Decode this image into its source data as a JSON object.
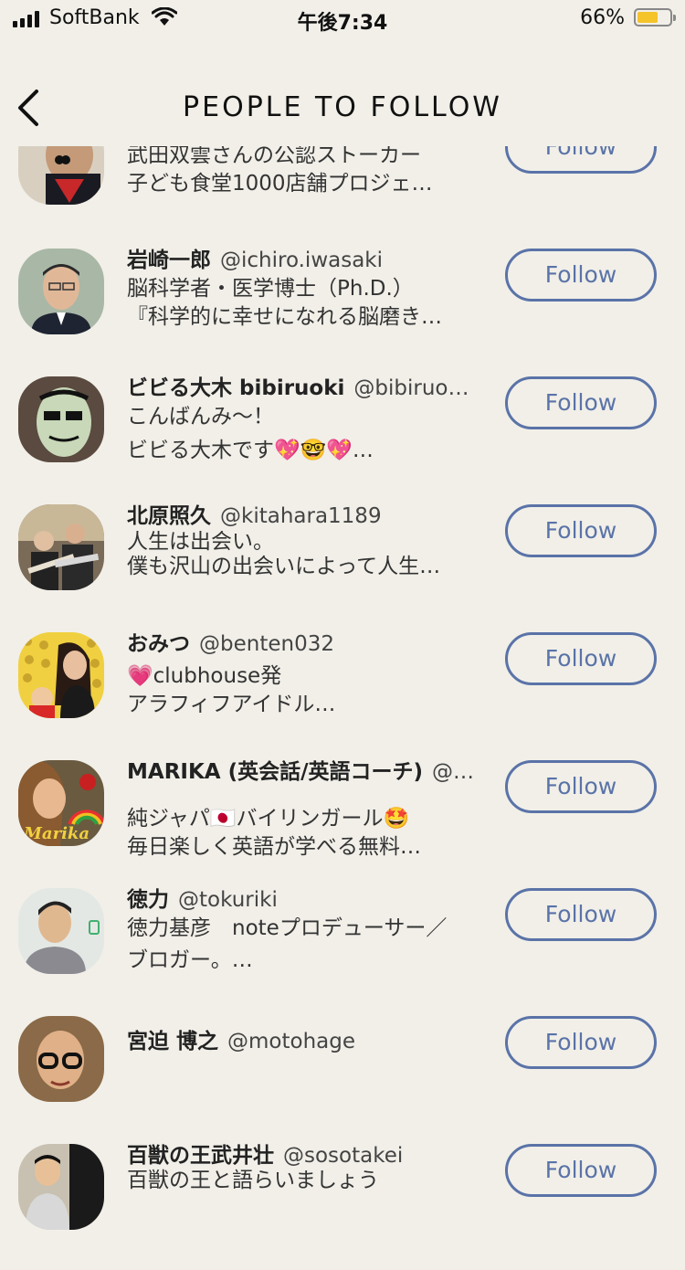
{
  "status": {
    "carrier": "SoftBank",
    "time": "午後7:34",
    "battery": "66%",
    "battery_level": 0.66
  },
  "header": {
    "title": "PEOPLE TO FOLLOW"
  },
  "people": [
    {
      "name": "",
      "handle": "",
      "bio1": "武田双雲さんの公認ストーカー",
      "bio2": "子ども食堂1000店舗プロジェ…",
      "follow_label": "Follow",
      "avatar_color": "#d8c8a8"
    },
    {
      "name": "岩崎一郎",
      "handle": "@ichiro.iwasaki",
      "bio1": "脳科学者・医学博士（Ph.D.）",
      "bio2": "『科学的に幸せになれる脳磨き…",
      "follow_label": "Follow",
      "avatar_color": "#b9c4cc"
    },
    {
      "name": "ビビる大木 bibiruoki",
      "handle": "@bibiruo…",
      "bio1": "こんばんみ〜！",
      "bio2": "ビビる大木です💖🤓💖…",
      "follow_label": "Follow",
      "avatar_color": "#6b5a4a"
    },
    {
      "name": "北原照久",
      "handle": "@kitahara1189",
      "bio1": "人生は出会い。",
      "bio2": "僕も沢山の出会いによって人生…",
      "follow_label": "Follow",
      "avatar_color": "#4a4038"
    },
    {
      "name": "おみつ",
      "handle": "@benten032",
      "bio1": "💗clubhouse発",
      "bio2": "アラフィフアイドル…",
      "follow_label": "Follow",
      "avatar_color": "#e8c63a"
    },
    {
      "name": "MARIKA (英会話/英語コーチ)",
      "handle": "@…",
      "bio1": "純ジャパ🇯🇵バイリンガール🤩",
      "bio2": "毎日楽しく英語が学べる無料…",
      "follow_label": "Follow",
      "avatar_color": "#c88a4a"
    },
    {
      "name": "徳力",
      "handle": "@tokuriki",
      "bio1": "徳力基彦　noteプロデューサー／",
      "bio2": "ブロガー。…",
      "follow_label": "Follow",
      "avatar_color": "#d6dcd8"
    },
    {
      "name": "宮迫 博之",
      "handle": "@motohage",
      "bio1": "",
      "bio2": "",
      "follow_label": "Follow",
      "avatar_color": "#9a7a5a"
    },
    {
      "name": "百獣の王武井壮",
      "handle": "@sosotakei",
      "bio1": "百獣の王と語らいましょう",
      "bio2": "",
      "follow_label": "Follow",
      "avatar_color": "#3a3a3a"
    }
  ]
}
